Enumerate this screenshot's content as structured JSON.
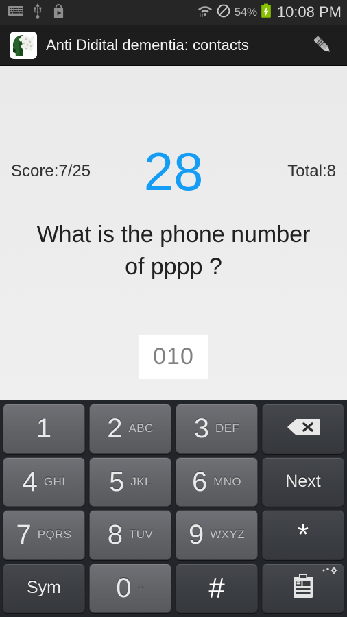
{
  "status_bar": {
    "left_icons": [
      "keyboard-icon",
      "usb-icon",
      "play-store-icon"
    ],
    "wifi_icon": "wifi-icon",
    "mute_icon": "do-not-disturb-icon",
    "battery_percent": "54%",
    "battery_icon": "battery-charging-icon",
    "clock": "10:08 PM"
  },
  "title_bar": {
    "app_icon": "brain-head-app-icon",
    "title": "Anti Didital dementia: contacts",
    "edit_icon": "pencil-icon"
  },
  "content": {
    "score": "Score:7/25",
    "timer": "28",
    "total": "Total:8",
    "question_line1": "What is the phone number",
    "question_line2": "of pppp ?",
    "answer_value": "010"
  },
  "colors": {
    "timer_blue": "#159df5",
    "status_bar_bg": "#262626",
    "title_bar_bg": "#1d1d1d",
    "content_bg": "#ececec",
    "battery_green": "#88c100",
    "keyboard_bg": "#22252a"
  },
  "keyboard": {
    "rows": [
      [
        {
          "digit": "1",
          "sub": "",
          "type": "num",
          "name": "key-1"
        },
        {
          "digit": "2",
          "sub": "ABC",
          "type": "num",
          "name": "key-2"
        },
        {
          "digit": "3",
          "sub": "DEF",
          "type": "num",
          "name": "key-3"
        },
        {
          "digit": "",
          "sub": "",
          "type": "fn",
          "name": "key-backspace",
          "icon": "backspace-icon"
        }
      ],
      [
        {
          "digit": "4",
          "sub": "GHI",
          "type": "num",
          "name": "key-4"
        },
        {
          "digit": "5",
          "sub": "JKL",
          "type": "num",
          "name": "key-5"
        },
        {
          "digit": "6",
          "sub": "MNO",
          "type": "num",
          "name": "key-6"
        },
        {
          "digit": "",
          "sub": "",
          "type": "fn",
          "name": "key-next",
          "label": "Next"
        }
      ],
      [
        {
          "digit": "7",
          "sub": "PQRS",
          "type": "num",
          "name": "key-7"
        },
        {
          "digit": "8",
          "sub": "TUV",
          "type": "num",
          "name": "key-8"
        },
        {
          "digit": "9",
          "sub": "WXYZ",
          "type": "num",
          "name": "key-9"
        },
        {
          "digit": "",
          "sub": "",
          "type": "fn",
          "name": "key-star",
          "label": "*"
        }
      ],
      [
        {
          "digit": "",
          "sub": "",
          "type": "fn",
          "name": "key-sym",
          "label": "Sym"
        },
        {
          "digit": "0",
          "sub": "+",
          "type": "num",
          "name": "key-0"
        },
        {
          "digit": "",
          "sub": "",
          "type": "fn",
          "name": "key-hash",
          "label": "#"
        },
        {
          "digit": "",
          "sub": "",
          "type": "fn",
          "name": "key-clipboard",
          "icon": "clipboard-icon"
        }
      ]
    ],
    "key_labels": {
      "next": "Next",
      "sym": "Sym",
      "star": "*",
      "hash": "#"
    }
  }
}
